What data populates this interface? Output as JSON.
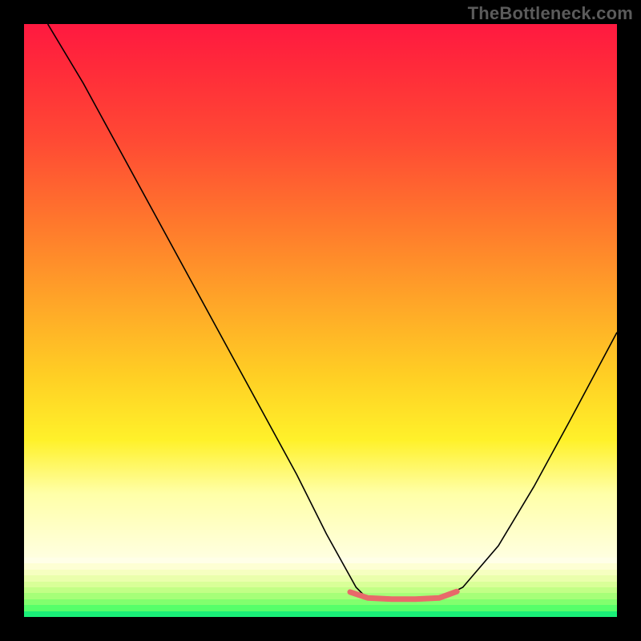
{
  "watermark": "TheBottleneck.com",
  "chart_data": {
    "type": "line",
    "title": "",
    "xlabel": "",
    "ylabel": "",
    "xlim": [
      0,
      100
    ],
    "ylim": [
      0,
      100
    ],
    "grid": false,
    "legend": false,
    "background_gradient": {
      "direction": "vertical",
      "type": "bottleneck_heatmap",
      "top_color": "#ff1940",
      "mid_color": "#ffe030",
      "bottom_band_start_pct": 90,
      "bottom_bands_hex": [
        "#ffffe8",
        "#fdffd4",
        "#f6ffc0",
        "#eaffac",
        "#d9ff98",
        "#c2ff86",
        "#a6ff78",
        "#82ff6e",
        "#56ff6a",
        "#1aef78"
      ]
    },
    "series": [
      {
        "name": "bottleneck-curve",
        "stroke": "#000000",
        "stroke_width": 1.6,
        "x": [
          4,
          10,
          16,
          22,
          28,
          34,
          40,
          46,
          51,
          56,
          58,
          62,
          66,
          70,
          74,
          80,
          86,
          92,
          100
        ],
        "y": [
          100,
          90,
          79,
          68,
          57,
          46,
          35,
          24,
          14,
          5,
          3,
          3,
          3,
          3,
          5,
          12,
          22,
          33,
          48
        ],
        "note": "y=100 is top of plot (worst/red). y≈3 is minimum brushing the green band."
      },
      {
        "name": "optimal-highlight",
        "stroke": "#e86a6a",
        "stroke_width": 7,
        "linecap": "round",
        "x": [
          55,
          58,
          62,
          66,
          70,
          73
        ],
        "y": [
          4.2,
          3.2,
          3.0,
          3.0,
          3.2,
          4.3
        ],
        "note": "thick salmon-pink segment marking the flat bottom of the V"
      }
    ]
  }
}
